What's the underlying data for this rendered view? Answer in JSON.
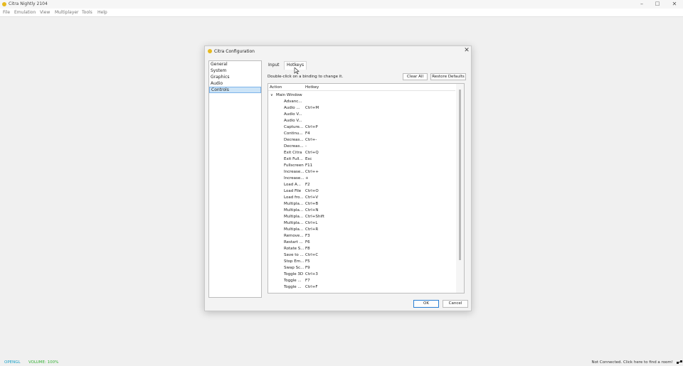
{
  "window": {
    "title": "Citra Nightly 2104",
    "controls": {
      "minimize": "–",
      "maximize": "□",
      "close": "✕"
    }
  },
  "menu": [
    "File",
    "Emulation",
    "View",
    "Multiplayer",
    "Tools",
    "Help"
  ],
  "status": {
    "renderer": "OPENGL",
    "volume": "VOLUME: 100%",
    "network": "Not Connected. Click here to find a room!"
  },
  "dialog": {
    "title": "Citra Configuration",
    "close": "✕",
    "categories": [
      "General",
      "System",
      "Graphics",
      "Audio",
      "Controls"
    ],
    "selected_category": "Controls",
    "tabs": [
      "Input",
      "Hotkeys"
    ],
    "active_tab": "Hotkeys",
    "hint": "Double-click on a binding to change it.",
    "clear_all": "Clear All",
    "restore_defaults": "Restore Defaults",
    "columns": {
      "action": "Action",
      "hotkey": "Hotkey"
    },
    "group": "Main Window",
    "hotkeys": [
      [
        "Advanc...",
        ""
      ],
      [
        "Audio ...",
        "Ctrl+M"
      ],
      [
        "Audio V...",
        ""
      ],
      [
        "Audio V...",
        ""
      ],
      [
        "Capture...",
        "Ctrl+P"
      ],
      [
        "Continu...",
        "F4"
      ],
      [
        "Decreas...",
        "Ctrl+-"
      ],
      [
        "Decreas...",
        "-"
      ],
      [
        "Exit Citra",
        "Ctrl+Q"
      ],
      [
        "Exit Full...",
        "Esc"
      ],
      [
        "Fullscreen",
        "F11"
      ],
      [
        "Increase...",
        "Ctrl++"
      ],
      [
        "Increase...",
        "+"
      ],
      [
        "Load A...",
        "F2"
      ],
      [
        "Load File",
        "Ctrl+O"
      ],
      [
        "Load fro...",
        "Ctrl+V"
      ],
      [
        "Multipla...",
        "Ctrl+B"
      ],
      [
        "Multipla...",
        "Ctrl+N"
      ],
      [
        "Multipla...",
        "Ctrl+Shift"
      ],
      [
        "Multipla...",
        "Ctrl+L"
      ],
      [
        "Multipla...",
        "Ctrl+R"
      ],
      [
        "Remove...",
        "F3"
      ],
      [
        "Restart ...",
        "F6"
      ],
      [
        "Rotate S...",
        "F8"
      ],
      [
        "Save to ...",
        "Ctrl+C"
      ],
      [
        "Stop Em...",
        "F5"
      ],
      [
        "Swap Sc...",
        "F9"
      ],
      [
        "Toggle 3D",
        "Ctrl+3"
      ],
      [
        "Toggle ...",
        "F7"
      ],
      [
        "Toggle ...",
        "Ctrl+F"
      ]
    ],
    "ok": "OK",
    "cancel": "Cancel"
  }
}
